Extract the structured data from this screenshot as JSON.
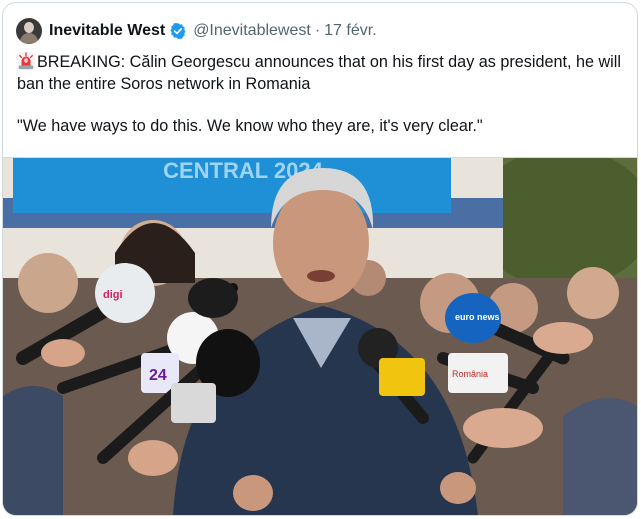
{
  "tweet": {
    "author_name": "Inevitable West",
    "handle": "@Inevitablewest",
    "separator": "·",
    "date": "17 févr.",
    "lines": [
      "BREAKING: Călin Georgescu announces that on his first day as president, he will ban the entire Soros network in Romania",
      "\"We have ways to do this. We know who they are, it's very clear.\""
    ],
    "icons": {
      "avatar": "avatar-image",
      "verified": "verified-badge-icon",
      "siren": "siren-emoji-icon"
    },
    "colors": {
      "verified": "#1d9bf0",
      "text": "#0f1419",
      "muted": "#536471"
    }
  },
  "photo": {
    "banner_text": "CENTRAL 2024",
    "mic_labels": [
      "digi",
      "24",
      "euro news",
      "România"
    ]
  }
}
